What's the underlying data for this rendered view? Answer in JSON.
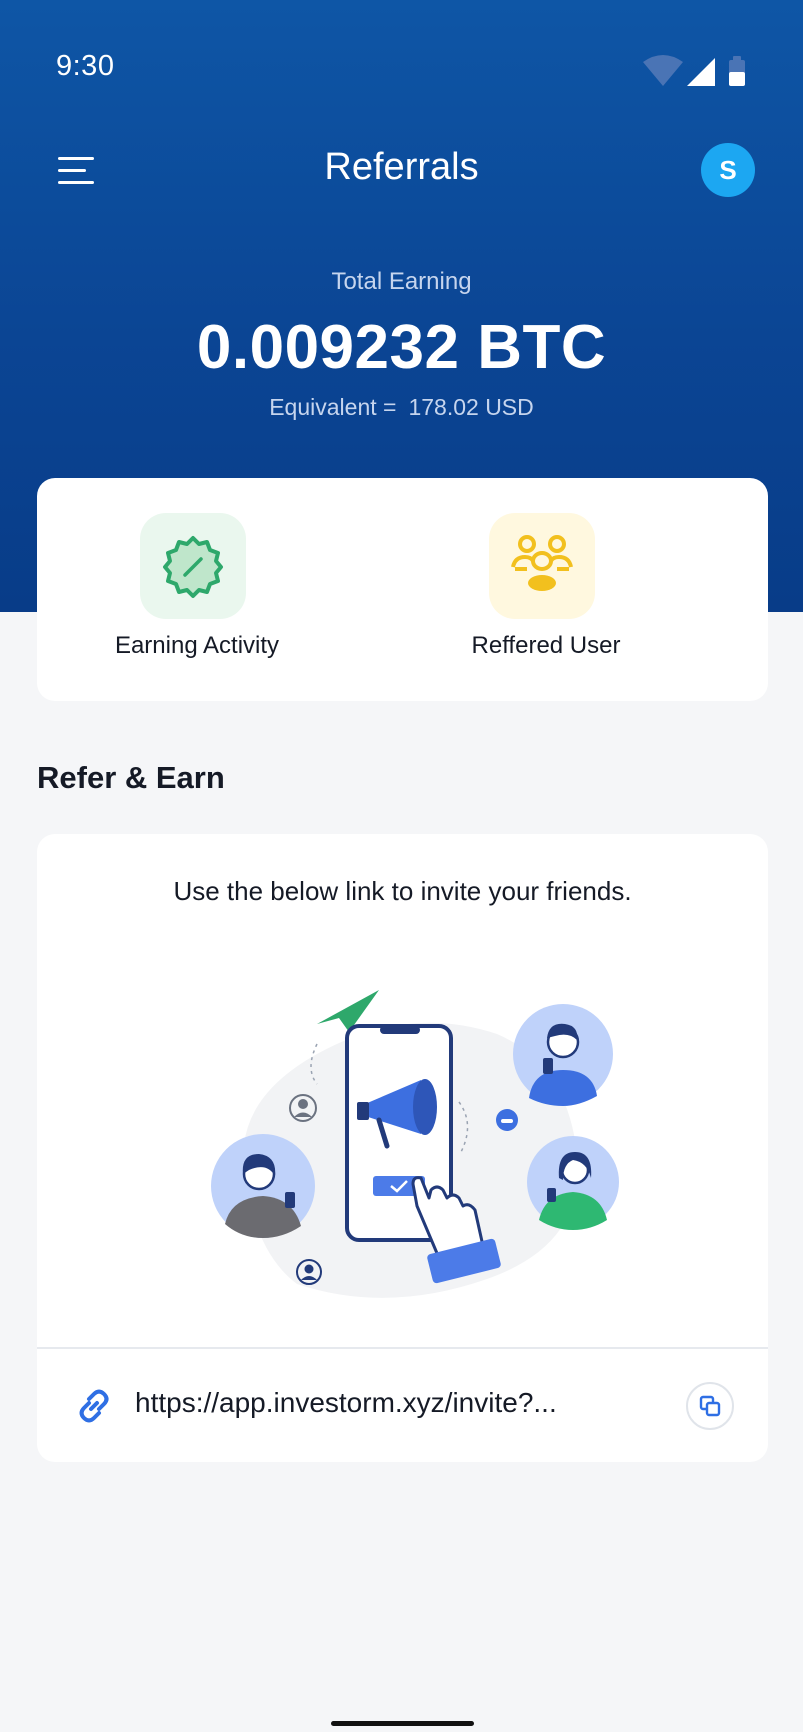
{
  "status_bar": {
    "time": "9:30"
  },
  "header": {
    "title": "Referrals",
    "avatar_initial": "S"
  },
  "earnings": {
    "label": "Total Earning",
    "value": "0.009232 BTC",
    "equivalent_label": "Equivalent =",
    "equivalent_value": "178.02 USD"
  },
  "quick_actions": [
    {
      "label": "Earning Activity",
      "icon": "discount-badge-icon"
    },
    {
      "label": "Reffered User",
      "icon": "users-group-icon"
    }
  ],
  "refer": {
    "section_title": "Refer & Earn",
    "description": "Use the below link to invite your friends.",
    "link": "https://app.investorm.xyz/invite?..."
  },
  "colors": {
    "header_blue": "#0B4594",
    "avatar_blue": "#1CA7F2",
    "accent_green": "#2EA86B",
    "accent_yellow": "#F2C01E",
    "link_blue": "#2F6FE4",
    "background": "#F5F6F8"
  }
}
